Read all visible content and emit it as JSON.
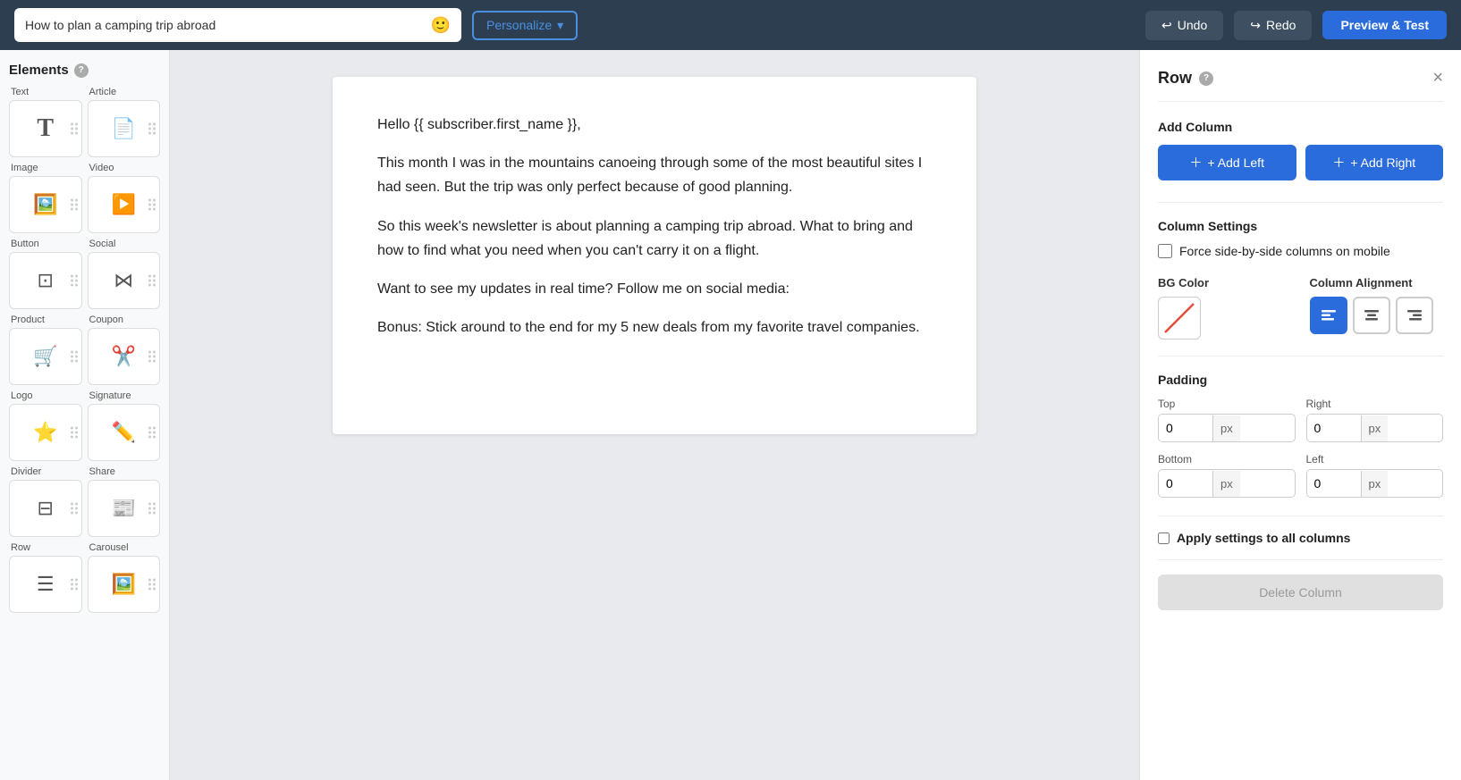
{
  "topbar": {
    "input_value": "How to plan a camping trip abroad",
    "input_placeholder": "How to plan a camping trip abroad",
    "personalize_label": "Personalize",
    "undo_label": "Undo",
    "redo_label": "Redo",
    "preview_label": "Preview & Test"
  },
  "sidebar": {
    "title": "Elements",
    "help_icon": "?",
    "categories": [
      {
        "left_label": "Text",
        "right_label": "Article",
        "left_icon": "T",
        "right_icon": "≡"
      },
      {
        "left_label": "Image",
        "right_label": "Video",
        "left_icon": "🖼",
        "right_icon": "▶"
      },
      {
        "left_label": "Button",
        "right_label": "Social",
        "left_icon": "⊡",
        "right_icon": "⋈"
      },
      {
        "left_label": "Product",
        "right_label": "Coupon",
        "left_icon": "🛒",
        "right_icon": "✂"
      },
      {
        "left_label": "Logo",
        "right_label": "Signature",
        "left_icon": "⭐",
        "right_icon": "✏"
      },
      {
        "left_label": "Divider",
        "right_label": "Share",
        "left_icon": "⊟",
        "right_icon": "⊡"
      },
      {
        "left_label": "Row",
        "right_label": "Carousel",
        "left_icon": "⊟",
        "right_icon": "🖼"
      }
    ]
  },
  "canvas": {
    "text_lines": [
      "Hello {{ subscriber.first_name }},",
      "This month I was in the mountains canoeing through some of the most beautiful sites I had seen. But the trip was only perfect because of good planning.",
      "So this week's newsletter is about planning a camping trip abroad. What to bring and how to find what you need when you can't carry it on a flight.",
      "Want to see my updates in real time? Follow me on social media:",
      "Bonus: Stick around to the end for my 5 new deals from my favorite travel companies."
    ]
  },
  "right_panel": {
    "title": "Row",
    "help_icon": "?",
    "close_icon": "×",
    "add_column_title": "Add Column",
    "add_left_label": "+ Add Left",
    "add_right_label": "+ Add Right",
    "column_settings_title": "Column Settings",
    "force_columns_label": "Force side-by-side columns on mobile",
    "bg_color_label": "BG Color",
    "column_alignment_label": "Column Alignment",
    "alignment_options": [
      "left",
      "center",
      "right"
    ],
    "padding_title": "Padding",
    "top_label": "Top",
    "right_label": "Right",
    "bottom_label": "Bottom",
    "left_label": "Left",
    "top_value": "0",
    "right_value": "0",
    "bottom_value": "0",
    "left_value": "0",
    "px_label": "px",
    "apply_all_label": "Apply settings to all columns",
    "delete_label": "Delete Column"
  }
}
